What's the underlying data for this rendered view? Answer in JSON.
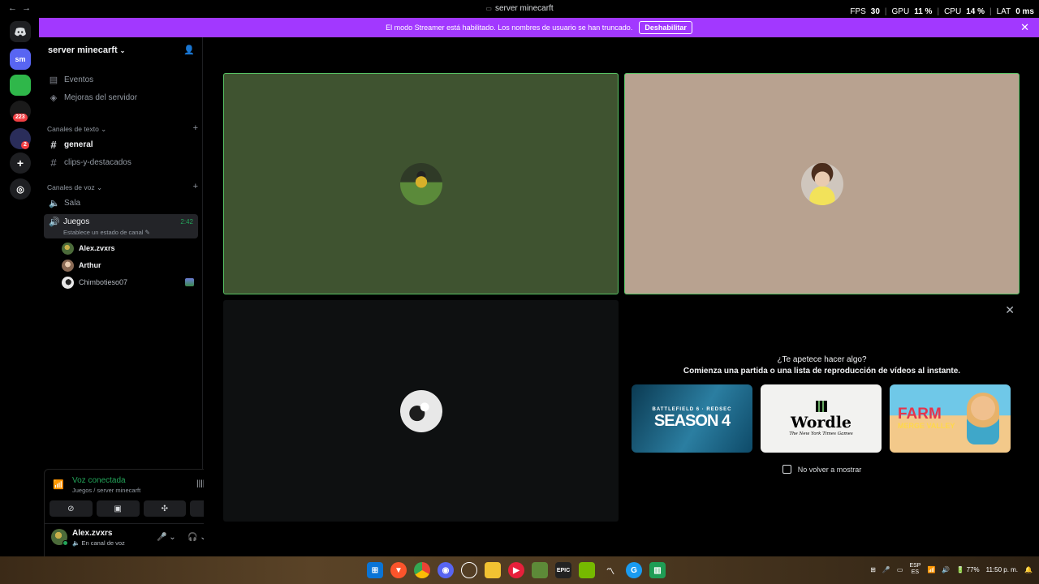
{
  "window": {
    "title": "server minecarft"
  },
  "overlay": {
    "fps_label": "FPS",
    "fps": "30",
    "gpu_label": "GPU",
    "gpu": "11 %",
    "cpu_label": "CPU",
    "cpu": "14 %",
    "lat_label": "LAT",
    "lat": "0 ms"
  },
  "rail": {
    "servers": [
      {
        "label": "sm",
        "icon": "server-sm-icon"
      },
      {
        "label": "",
        "icon": "green-server-icon"
      },
      {
        "label": "",
        "icon": "server-icon",
        "badge": "223"
      },
      {
        "label": "",
        "icon": "server-icon",
        "badge": "2"
      }
    ],
    "add_icon": "plus-icon",
    "discover_icon": "compass-icon"
  },
  "banner": {
    "text": "El modo Streamer está habilitado. Los nombres de usuario se han truncado.",
    "button": "Deshabilitar"
  },
  "sidebar": {
    "server_name": "server minecarft",
    "top_items": [
      {
        "label": "Eventos",
        "icon": "calendar-icon"
      },
      {
        "label": "Mejoras del servidor",
        "icon": "boost-icon"
      }
    ],
    "text_category": "Canales de texto",
    "text_channels": [
      {
        "label": "general",
        "active": true
      },
      {
        "label": "clips-y-destacados",
        "active": false
      }
    ],
    "voice_category": "Canales de voz",
    "voice_channels": [
      {
        "label": "Sala"
      }
    ],
    "active_voice": {
      "name": "Juegos",
      "time": "2:42",
      "status": "Establece un estado de canal"
    },
    "voice_users": [
      {
        "name": "Alex.zvxrs"
      },
      {
        "name": "Arthur"
      },
      {
        "name": "Chimbotieso07"
      }
    ]
  },
  "voice_panel": {
    "status": "Voz conectada",
    "location": "Juegos / server minecarft",
    "user_name": "Alex.zvxrs",
    "user_status": "En canal de voz"
  },
  "activity": {
    "question": "¿Te apetece hacer algo?",
    "subtitle": "Comienza una partida o una lista de reproducción de vídeos al instante.",
    "cards": [
      {
        "small": "BATTLEFIELD 6 · REDSEC",
        "big": "SEASON 4"
      },
      {
        "big": "Wordle",
        "small": "The New York Times Games"
      },
      {
        "big": "FARM",
        "small": "MERGE VALLEY"
      }
    ],
    "dont_show": "No volver a mostrar"
  },
  "taskbar": {
    "time": "11:50 p. m.",
    "lang": "ESP",
    "lang_sub": "ES",
    "battery": "77%"
  }
}
